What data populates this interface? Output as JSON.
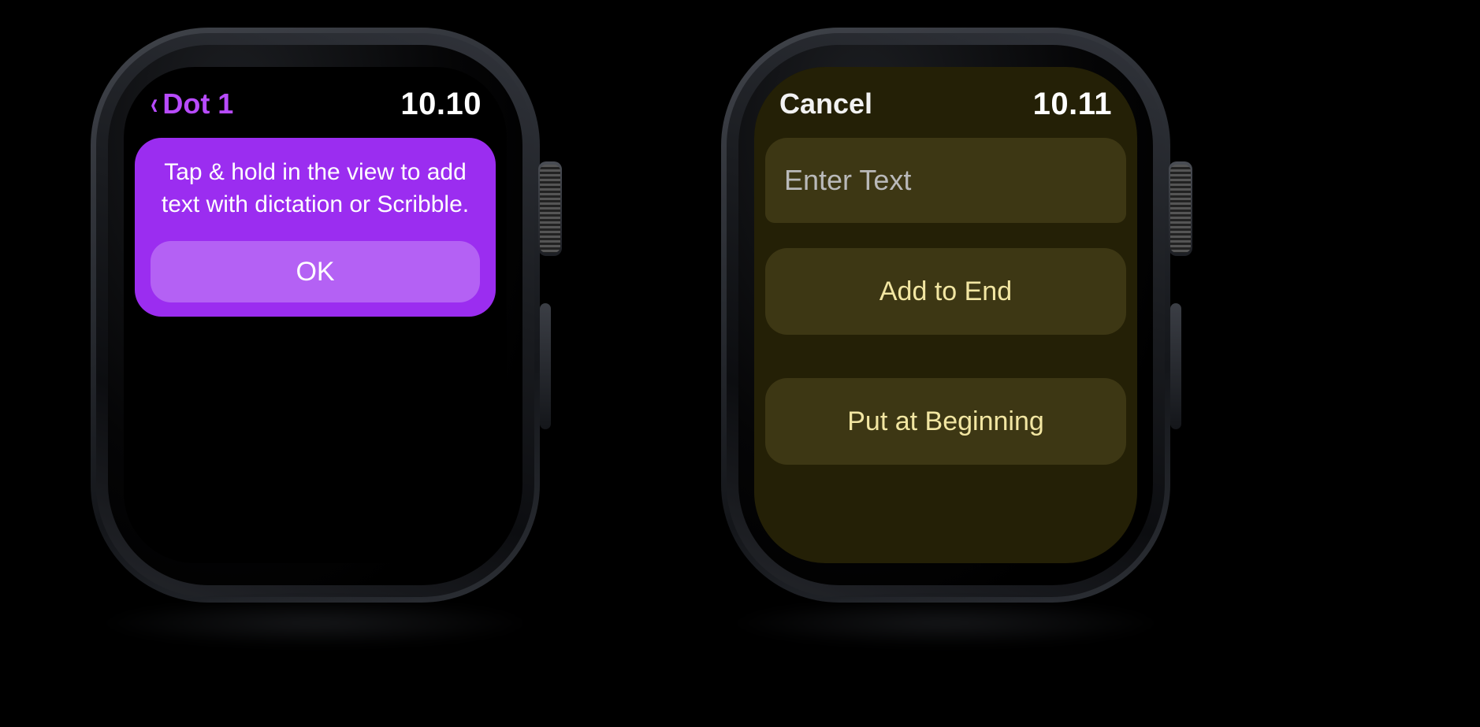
{
  "left": {
    "back_label": "Dot 1",
    "time": "10.10",
    "alert_message": "Tap & hold in the view to add text with dictation or Scribble.",
    "ok_label": "OK",
    "accent": "#b84bff"
  },
  "right": {
    "cancel_label": "Cancel",
    "time": "10.11",
    "input_placeholder": "Enter Text",
    "option_add_end": "Add to End",
    "option_put_begin": "Put at Beginning",
    "accent": "#f2e6a2"
  }
}
